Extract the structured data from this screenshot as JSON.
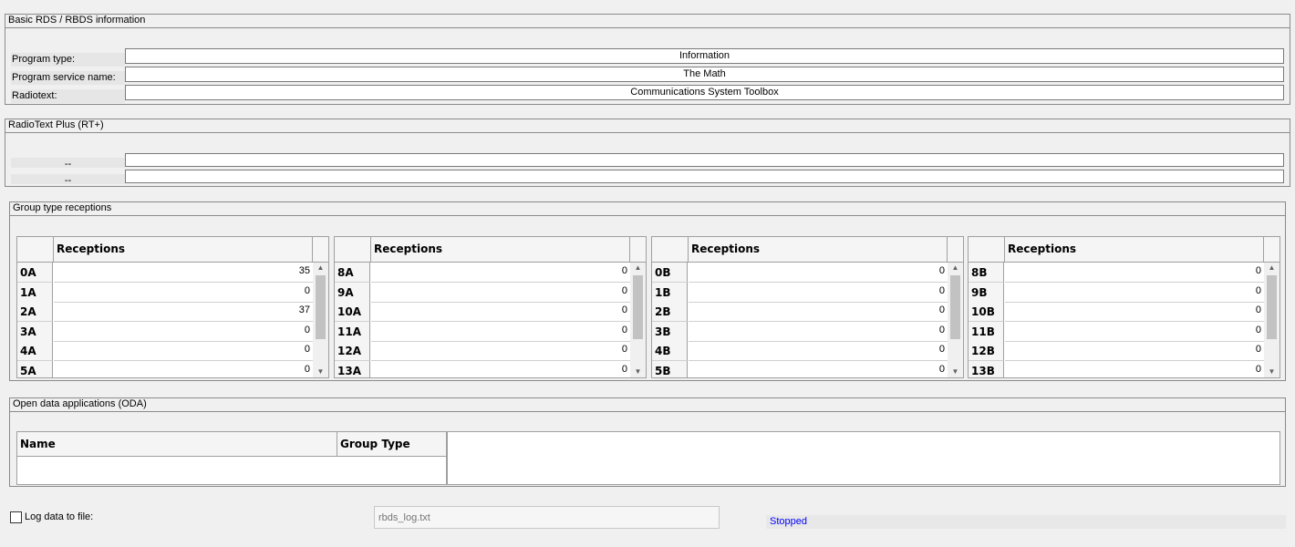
{
  "basic": {
    "title": "Basic RDS / RBDS information",
    "program_type_label": "Program type:",
    "program_type_value": "Information",
    "ps_name_label": "Program service name:",
    "ps_name_value": "The Math",
    "radiotext_label": "Radiotext:",
    "radiotext_value": "Communications System Toolbox"
  },
  "rtplus": {
    "title": "RadioText Plus (RT+)",
    "item1_label": "--",
    "item1_value": "",
    "item2_label": "--",
    "item2_value": ""
  },
  "group_types": {
    "title": "Group type receptions",
    "tables": [
      {
        "column": "Receptions",
        "rows": [
          {
            "name": "0A",
            "value": "35"
          },
          {
            "name": "1A",
            "value": "0"
          },
          {
            "name": "2A",
            "value": "37"
          },
          {
            "name": "3A",
            "value": "0"
          },
          {
            "name": "4A",
            "value": "0"
          },
          {
            "name": "5A",
            "value": "0"
          }
        ]
      },
      {
        "column": "Receptions",
        "rows": [
          {
            "name": "8A",
            "value": "0"
          },
          {
            "name": "9A",
            "value": "0"
          },
          {
            "name": "10A",
            "value": "0"
          },
          {
            "name": "11A",
            "value": "0"
          },
          {
            "name": "12A",
            "value": "0"
          },
          {
            "name": "13A",
            "value": "0"
          }
        ]
      },
      {
        "column": "Receptions",
        "rows": [
          {
            "name": "0B",
            "value": "0"
          },
          {
            "name": "1B",
            "value": "0"
          },
          {
            "name": "2B",
            "value": "0"
          },
          {
            "name": "3B",
            "value": "0"
          },
          {
            "name": "4B",
            "value": "0"
          },
          {
            "name": "5B",
            "value": "0"
          }
        ]
      },
      {
        "column": "Receptions",
        "rows": [
          {
            "name": "8B",
            "value": "0"
          },
          {
            "name": "9B",
            "value": "0"
          },
          {
            "name": "10B",
            "value": "0"
          },
          {
            "name": "11B",
            "value": "0"
          },
          {
            "name": "12B",
            "value": "0"
          },
          {
            "name": "13B",
            "value": "0"
          }
        ]
      }
    ]
  },
  "oda": {
    "title": "Open data applications (ODA)",
    "col_name": "Name",
    "col_group_type": "Group Type"
  },
  "log": {
    "checkbox_label": "Log data to file:",
    "checked": false,
    "file_placeholder": "rbds_log.txt",
    "status": "Stopped",
    "status_color": "#0000ff"
  },
  "icons": {
    "scroll_up": "scroll-up-arrow",
    "scroll_down": "scroll-down-arrow"
  }
}
